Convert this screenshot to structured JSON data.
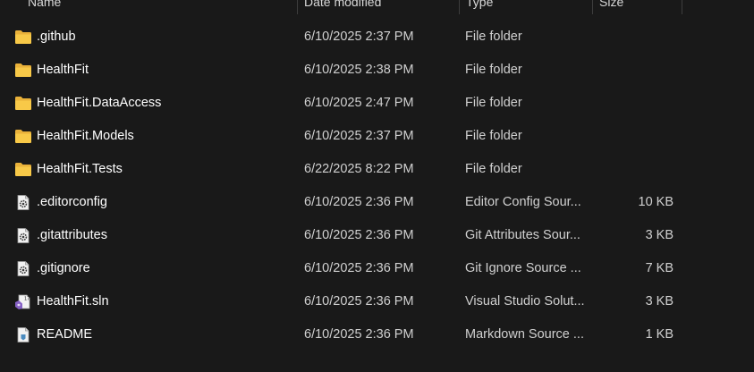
{
  "columns": {
    "name": "Name",
    "date_modified": "Date modified",
    "type": "Type",
    "size": "Size"
  },
  "files": [
    {
      "name": ".github",
      "date": "6/10/2025 2:37 PM",
      "type": "File folder",
      "size": "",
      "icon": "folder-icon"
    },
    {
      "name": "HealthFit",
      "date": "6/10/2025 2:38 PM",
      "type": "File folder",
      "size": "",
      "icon": "folder-icon"
    },
    {
      "name": "HealthFit.DataAccess",
      "date": "6/10/2025 2:47 PM",
      "type": "File folder",
      "size": "",
      "icon": "folder-icon"
    },
    {
      "name": "HealthFit.Models",
      "date": "6/10/2025 2:37 PM",
      "type": "File folder",
      "size": "",
      "icon": "folder-icon"
    },
    {
      "name": "HealthFit.Tests",
      "date": "6/22/2025 8:22 PM",
      "type": "File folder",
      "size": "",
      "icon": "folder-icon"
    },
    {
      "name": ".editorconfig",
      "date": "6/10/2025 2:36 PM",
      "type": "Editor Config Sour...",
      "size": "10 KB",
      "icon": "settings-file-icon"
    },
    {
      "name": ".gitattributes",
      "date": "6/10/2025 2:36 PM",
      "type": "Git Attributes Sour...",
      "size": "3 KB",
      "icon": "settings-file-icon"
    },
    {
      "name": ".gitignore",
      "date": "6/10/2025 2:36 PM",
      "type": "Git Ignore Source ...",
      "size": "7 KB",
      "icon": "settings-file-icon"
    },
    {
      "name": "HealthFit.sln",
      "date": "6/10/2025 2:36 PM",
      "type": "Visual Studio Solut...",
      "size": "3 KB",
      "icon": "visual-studio-solution-icon"
    },
    {
      "name": "README",
      "date": "6/10/2025 2:36 PM",
      "type": "Markdown Source ...",
      "size": "1 KB",
      "icon": "markdown-file-icon"
    }
  ],
  "colors": {
    "background": "#191919",
    "folder": "#f6c445",
    "text": "#ffffff",
    "secondary_text": "#d0d0d0"
  }
}
